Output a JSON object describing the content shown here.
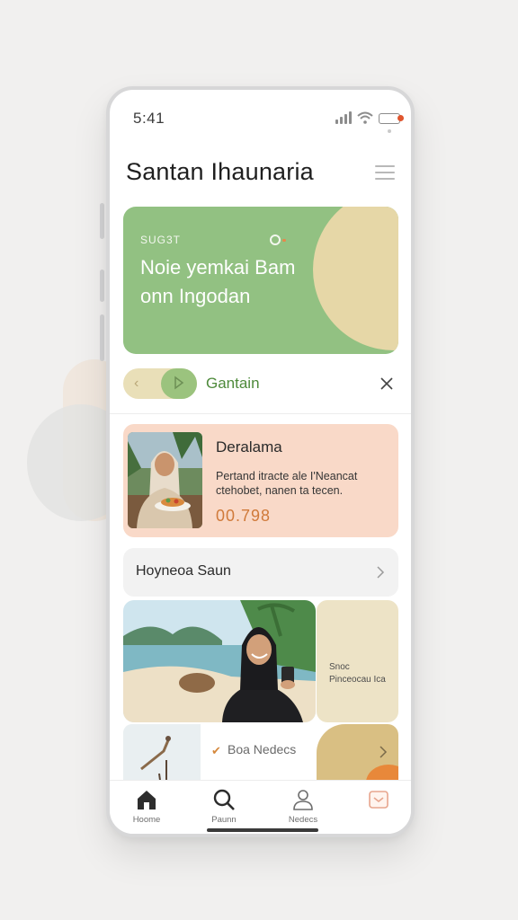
{
  "status_bar": {
    "time": "5:41"
  },
  "header": {
    "title": "Santan Ihaunaria"
  },
  "hero": {
    "eyebrow": "SUG3T",
    "line1": "Noie yemkai Bam",
    "line2": "onn Ingodan"
  },
  "filter": {
    "label": "Gantain"
  },
  "promo": {
    "title": "Deralama",
    "description": "Pertand itracte ale I'Neancat ctehobet, nanen ta tecen.",
    "price": "00.798"
  },
  "list_item": {
    "label": "Hoyneoa Saun"
  },
  "side_card": {
    "line1": "Snoc",
    "line2": "Pinceocau Ica"
  },
  "bottom_card": {
    "label": "Boa Nedecs"
  },
  "tabs": [
    {
      "label": "Hoome",
      "icon": "home-icon"
    },
    {
      "label": "Paunn",
      "icon": "search-icon"
    },
    {
      "label": "Nedecs",
      "icon": "profile-icon"
    },
    {
      "label": "",
      "icon": "calendar-icon"
    }
  ],
  "colors": {
    "hero_green": "#92c182",
    "hero_cream": "#e6d7a7",
    "promo_peach": "#f9d9c8",
    "accent_orange": "#d07a3a",
    "filter_green": "#4e8a3b"
  }
}
